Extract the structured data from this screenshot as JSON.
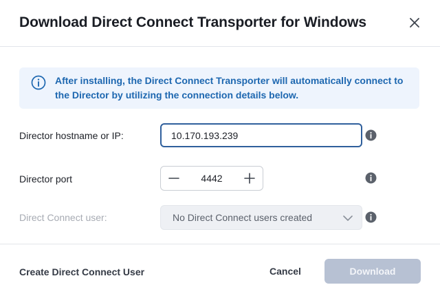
{
  "dialog": {
    "title": "Download Direct Connect Transporter for Windows",
    "close_icon": "close-icon"
  },
  "banner": {
    "icon": "info-circle-icon",
    "text": "After installing, the Direct Connect Transporter will automatically connect to the Director by utilizing the connection details below.",
    "color": "#1d67b0",
    "background": "#eef4fd"
  },
  "form": {
    "hostname_label": "Director hostname or IP:",
    "hostname_value": "10.170.193.239",
    "port_label": "Director port",
    "port_value": "4442",
    "user_label": "Direct Connect user:",
    "user_selected": "No Direct Connect users created",
    "info_icon": "info-icon"
  },
  "footer": {
    "create_user_label": "Create Direct Connect User",
    "cancel_label": "Cancel",
    "download_label": "Download"
  },
  "colors": {
    "input_focus_border": "#2f5f9c",
    "download_disabled": "#b7c1d3",
    "icon_gray": "#5b616b"
  }
}
